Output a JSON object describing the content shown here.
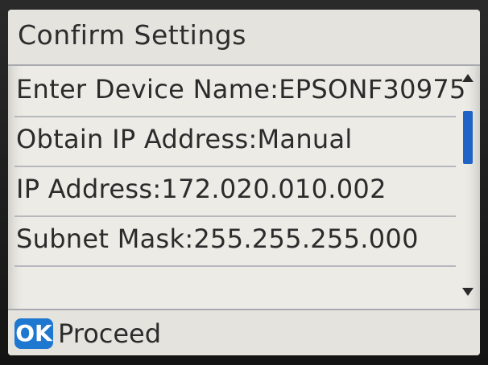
{
  "screen": {
    "title": "Confirm Settings"
  },
  "settings": [
    {
      "label": "Enter Device Name",
      "value": "EPSONF30975"
    },
    {
      "label": "Obtain IP Address",
      "value": "Manual"
    },
    {
      "label": "IP Address",
      "value": "172.020.010.002"
    },
    {
      "label": "Subnet Mask",
      "value": "255.255.255.000"
    }
  ],
  "rows_text": [
    "Enter Device Name:EPSONF30975",
    "Obtain IP Address:Manual",
    "IP Address:172.020.010.002",
    "Subnet Mask:255.255.255.000"
  ],
  "footer": {
    "ok_label": "OK",
    "action_label": "Proceed"
  },
  "icons": {
    "scroll_up": "scroll-up-arrow-icon",
    "scroll_down": "scroll-down-arrow-icon"
  },
  "colors": {
    "accent": "#1e78d0",
    "scroll_thumb": "#1f63c6",
    "screen_bg": "#ecebe6",
    "text": "#2b2b2b"
  }
}
